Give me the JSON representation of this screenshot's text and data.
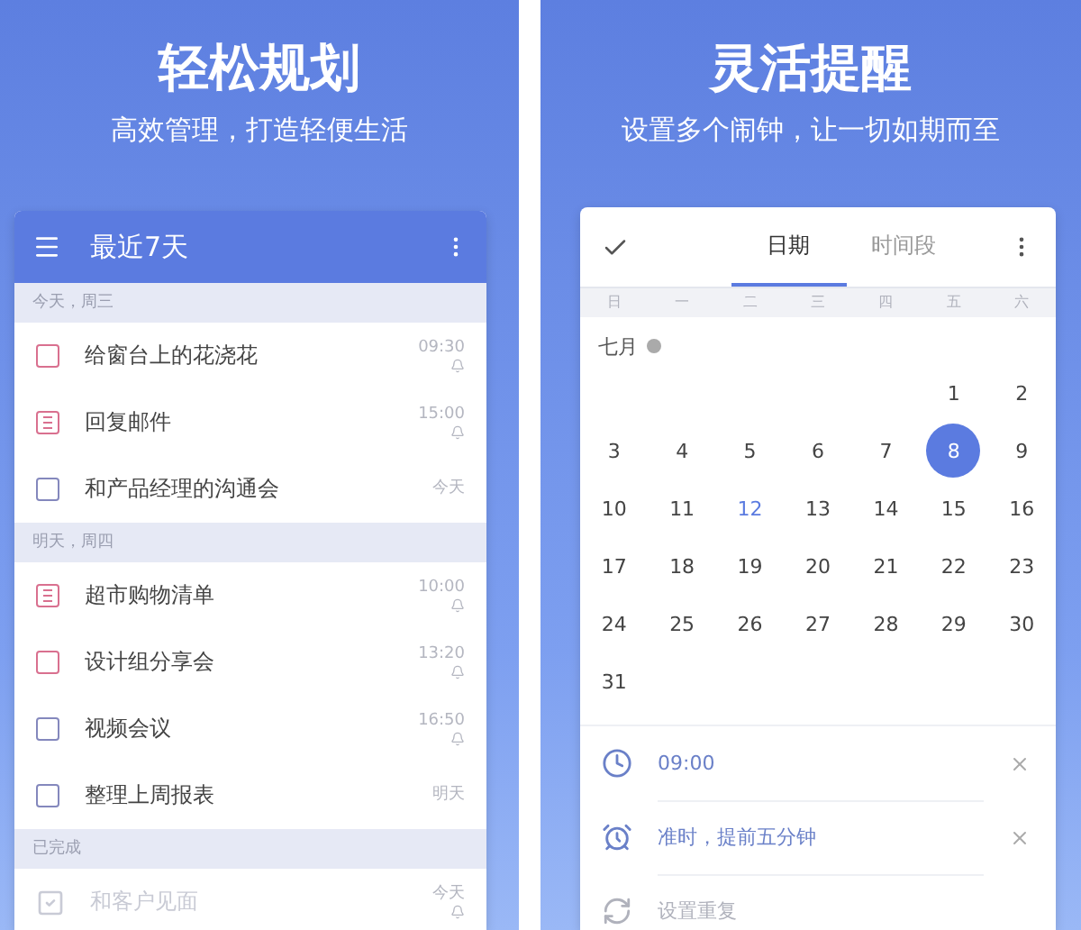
{
  "panels": [
    {
      "kind": "list",
      "title": "轻松规划",
      "subtitle": "高效管理，打造轻便生活",
      "list": {
        "header": "最近7天",
        "groups": [
          {
            "label": "今天，周三",
            "tasks": [
              {
                "title": "给窗台上的花浇花",
                "time": "09:30",
                "reminder": true,
                "kind": "checkbox",
                "color": "#d9708f",
                "checked": false
              },
              {
                "title": "回复邮件",
                "time": "15:00",
                "reminder": true,
                "kind": "note",
                "color": "#d9708f",
                "checked": false
              },
              {
                "title": "和产品经理的沟通会",
                "time": "今天",
                "reminder": false,
                "kind": "checkbox",
                "color": "#8488bd",
                "checked": false
              }
            ]
          },
          {
            "label": "明天，周四",
            "tasks": [
              {
                "title": "超市购物清单",
                "time": "10:00",
                "reminder": true,
                "kind": "note",
                "color": "#d9708f",
                "checked": false
              },
              {
                "title": "设计组分享会",
                "time": "13:20",
                "reminder": true,
                "kind": "checkbox",
                "color": "#d9708f",
                "checked": false
              },
              {
                "title": "视频会议",
                "time": "16:50",
                "reminder": true,
                "kind": "checkbox",
                "color": "#8488bd",
                "checked": false
              },
              {
                "title": "整理上周报表",
                "time": "明天",
                "reminder": false,
                "kind": "checkbox",
                "color": "#8488bd",
                "checked": false
              }
            ]
          },
          {
            "label": "已完成",
            "tasks": [
              {
                "title": "和客户见面",
                "time": "今天",
                "reminder": true,
                "kind": "checkbox",
                "color": "#c9cbd6",
                "checked": true
              }
            ]
          }
        ]
      }
    },
    {
      "kind": "picker",
      "title": "灵活提醒",
      "subtitle": "设置多个闹钟，让一切如期而至",
      "picker": {
        "tabs": [
          {
            "label": "日期",
            "selected": true
          },
          {
            "label": "时间段",
            "selected": false
          }
        ],
        "weekdays": [
          "日",
          "一",
          "二",
          "三",
          "四",
          "五",
          "六"
        ],
        "month": "七月",
        "weeks": [
          [
            {
              "label": "1",
              "selected": false,
              "today": false
            },
            {
              "label": "2",
              "selected": false,
              "today": false
            }
          ],
          [
            {
              "label": "3",
              "selected": false,
              "today": false
            },
            {
              "label": "4",
              "selected": false,
              "today": false
            },
            {
              "label": "5",
              "selected": false,
              "today": false
            },
            {
              "label": "6",
              "selected": false,
              "today": false
            },
            {
              "label": "7",
              "selected": false,
              "today": false
            },
            {
              "label": "8",
              "selected": true,
              "today": false
            },
            {
              "label": "9",
              "selected": false,
              "today": false
            }
          ],
          [
            {
              "label": "10",
              "selected": false,
              "today": false
            },
            {
              "label": "11",
              "selected": false,
              "today": false
            },
            {
              "label": "12",
              "selected": false,
              "today": true
            },
            {
              "label": "13",
              "selected": false,
              "today": false
            },
            {
              "label": "14",
              "selected": false,
              "today": false
            },
            {
              "label": "15",
              "selected": false,
              "today": false
            },
            {
              "label": "16",
              "selected": false,
              "today": false
            }
          ],
          [
            {
              "label": "17",
              "selected": false,
              "today": false
            },
            {
              "label": "18",
              "selected": false,
              "today": false
            },
            {
              "label": "19",
              "selected": false,
              "today": false
            },
            {
              "label": "20",
              "selected": false,
              "today": false
            },
            {
              "label": "21",
              "selected": false,
              "today": false
            },
            {
              "label": "22",
              "selected": false,
              "today": false
            },
            {
              "label": "23",
              "selected": false,
              "today": false
            }
          ],
          [
            {
              "label": "24",
              "selected": false,
              "today": false
            },
            {
              "label": "25",
              "selected": false,
              "today": false
            },
            {
              "label": "26",
              "selected": false,
              "today": false
            },
            {
              "label": "27",
              "selected": false,
              "today": false
            },
            {
              "label": "28",
              "selected": false,
              "today": false
            },
            {
              "label": "29",
              "selected": false,
              "today": false
            },
            {
              "label": "30",
              "selected": false,
              "today": false
            }
          ],
          [
            {
              "label": "31",
              "selected": false,
              "today": false
            }
          ]
        ],
        "options": [
          {
            "kind": "time",
            "text": "09:00",
            "active": true
          },
          {
            "kind": "alarm",
            "text": "准时，提前五分钟",
            "active": true
          },
          {
            "kind": "repeat",
            "text": "设置重复",
            "active": false
          }
        ]
      }
    }
  ]
}
